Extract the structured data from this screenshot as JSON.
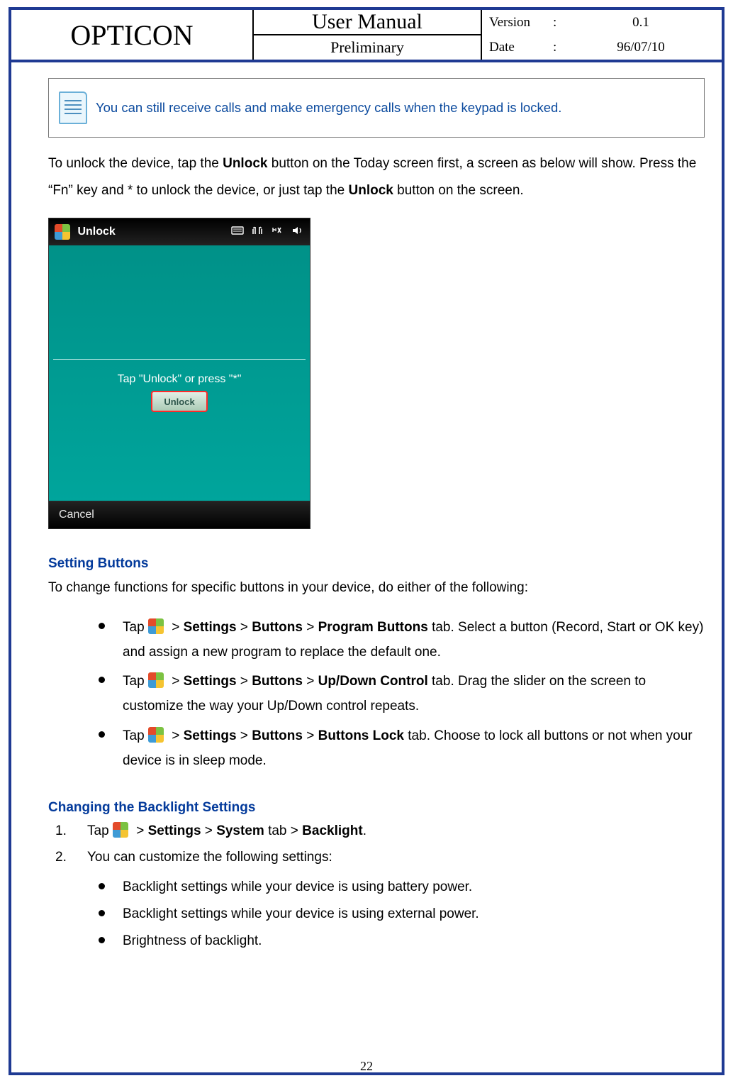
{
  "header": {
    "brand": "OPTICON",
    "title": "User Manual",
    "subtitle": "Preliminary",
    "version_label": "Version",
    "version_value": "0.1",
    "date_label": "Date",
    "date_value": "96/07/10",
    "colon": ":"
  },
  "note": {
    "text": "You can still receive calls and make emergency calls when the keypad is locked."
  },
  "unlock_para": {
    "t1": "To unlock the device, tap the ",
    "b1": "Unlock",
    "t2": " button on the Today screen first, a screen as below will show. Press the “Fn” key and * to unlock the device, or just tap the ",
    "b2": "Unlock",
    "t3": " button on the screen."
  },
  "screenshot": {
    "title_label": "Unlock",
    "hint": "Tap \"Unlock\" or press \"*\"",
    "unlock_btn": "Unlock",
    "softkey_left": "Cancel"
  },
  "section_buttons": {
    "heading": "Setting Buttons",
    "intro": "To change functions for specific buttons in your device, do either of the following:",
    "items": [
      {
        "pre": "Tap ",
        "b1": "Settings",
        "b2": "Buttons",
        "b3": "Program Buttons",
        "post": " tab. Select a button (Record, Start or OK key) and assign a new program to replace the default one."
      },
      {
        "pre": "Tap ",
        "b1": "Settings",
        "b2": "Buttons",
        "b3": "Up/Down Control",
        "post": " tab. Drag the slider on the screen to customize the way your Up/Down control repeats."
      },
      {
        "pre": "Tap ",
        "b1": "Settings",
        "b2": "Buttons",
        "b3": "Buttons Lock",
        "post": " tab. Choose to lock all buttons or not when your device is in sleep mode."
      }
    ],
    "gt": " > "
  },
  "section_backlight": {
    "heading": "Changing the Backlight Settings",
    "steps": [
      {
        "pre": "Tap ",
        "b1": "Settings",
        "b2": "System",
        "mid": " tab > ",
        "b3": "Backlight",
        "post": "."
      },
      {
        "text": "You can customize the following settings:"
      }
    ],
    "subs": [
      "Backlight settings while your device is using battery power.",
      "Backlight settings while your device is using external power.",
      "Brightness of backlight."
    ],
    "gt": " > "
  },
  "page_number": "22"
}
